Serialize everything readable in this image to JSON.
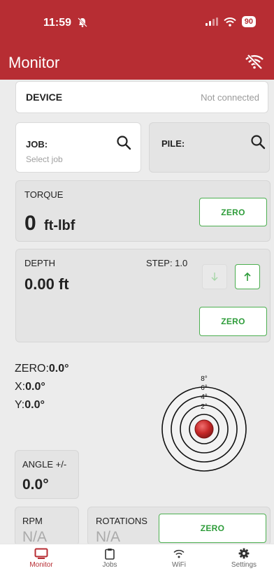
{
  "status_bar": {
    "time": "11:59",
    "battery": "90"
  },
  "header": {
    "title": "Monitor"
  },
  "device": {
    "label": "DEVICE",
    "status": "Not connected"
  },
  "job": {
    "label": "JOB:",
    "placeholder": "Select job"
  },
  "pile": {
    "label": "PILE:"
  },
  "torque": {
    "label": "TORQUE",
    "value": "0",
    "unit": "ft-lbf",
    "zero_label": "ZERO"
  },
  "depth": {
    "label": "DEPTH",
    "step": "STEP: 1.0",
    "value": "0.00 ft",
    "zero_label": "ZERO"
  },
  "tilt": {
    "zero_label": "ZERO:",
    "zero_value": "0.0°",
    "x_label": "X:",
    "x_value": "0.0°",
    "y_label": "Y:",
    "y_value": "0.0°",
    "rings": [
      "8°",
      "6°",
      "4°",
      "2°"
    ]
  },
  "angle": {
    "label": "ANGLE +/-",
    "value": "0.0°"
  },
  "rpm": {
    "label": "RPM",
    "value": "N/A"
  },
  "rotations": {
    "label": "ROTATIONS",
    "value": "N/A",
    "zero_label": "ZERO"
  },
  "tabs": [
    {
      "label": "Monitor",
      "icon": "monitor-icon"
    },
    {
      "label": "Jobs",
      "icon": "clipboard-icon"
    },
    {
      "label": "WiFi",
      "icon": "wifi-icon"
    },
    {
      "label": "Settings",
      "icon": "gear-icon"
    }
  ],
  "colors": {
    "brand": "#b72d33",
    "accent": "#4caf50",
    "ball": "#c62828"
  }
}
